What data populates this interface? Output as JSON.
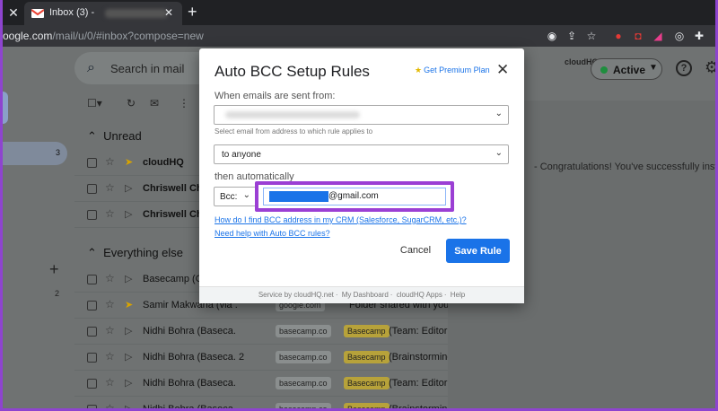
{
  "browser": {
    "tab_title": "Inbox (3) -",
    "url_host": "oogle.com",
    "url_path": "/mail/u/0/#inbox?compose=new"
  },
  "gmail": {
    "search_placeholder": "Search in mail",
    "status": "Active",
    "cloudhq_badge": "cloudHQ",
    "unread_count": "3",
    "left_count": "2",
    "sections": {
      "unread": "Unread",
      "everything_else": "Everything else"
    },
    "unread_rows": [
      {
        "sender": "cloudHQ",
        "important": true
      },
      {
        "sender": "Chriswell Ch",
        "important": false
      },
      {
        "sender": "Chriswell Ch",
        "important": false
      }
    ],
    "other_rows": [
      {
        "sender": "Basecamp (G",
        "chip": "",
        "label": "",
        "subject": ""
      },
      {
        "sender": "Samir Makwana (via .",
        "chip": "google.com",
        "label": "",
        "subject": "Folder shared with you: \"Le"
      },
      {
        "sender": "Nidhi Bohra (Baseca.",
        "chip": "basecamp.co",
        "label": "Basecamp",
        "subject": "(Team: Editori"
      },
      {
        "sender": "Nidhi Bohra (Baseca. 2",
        "chip": "basecamp.co",
        "label": "Basecamp",
        "subject": "(Brainstorming"
      },
      {
        "sender": "Nidhi Bohra (Baseca.",
        "chip": "basecamp.co",
        "label": "Basecamp",
        "subject": "(Team: Editori"
      },
      {
        "sender": "Nidhi Bohra (Baseca.",
        "chip": "basecamp.co",
        "label": "Basecamp",
        "subject": "(Brainstormin"
      }
    ],
    "preview_message": "- Congratulations! You've successfully installed"
  },
  "dialog": {
    "title": "Auto BCC Setup Rules",
    "premium_link": "Get Premium Plan",
    "from_label": "When emails are sent from:",
    "from_hint": "Select email from address to which rule applies to",
    "to_value": "to anyone",
    "then_label": "then automatically",
    "bcc_value": "Bcc:",
    "email_suffix": "@gmail.com",
    "link_crm": "How do I find BCC address in my CRM (Salesforce, SugarCRM, etc.)?",
    "link_help": "Need help with Auto BCC rules?",
    "cancel_label": "Cancel",
    "save_label": "Save Rule",
    "footer": [
      "Service by cloudHQ.net",
      "My Dashboard",
      "cloudHQ Apps",
      "Help"
    ]
  }
}
